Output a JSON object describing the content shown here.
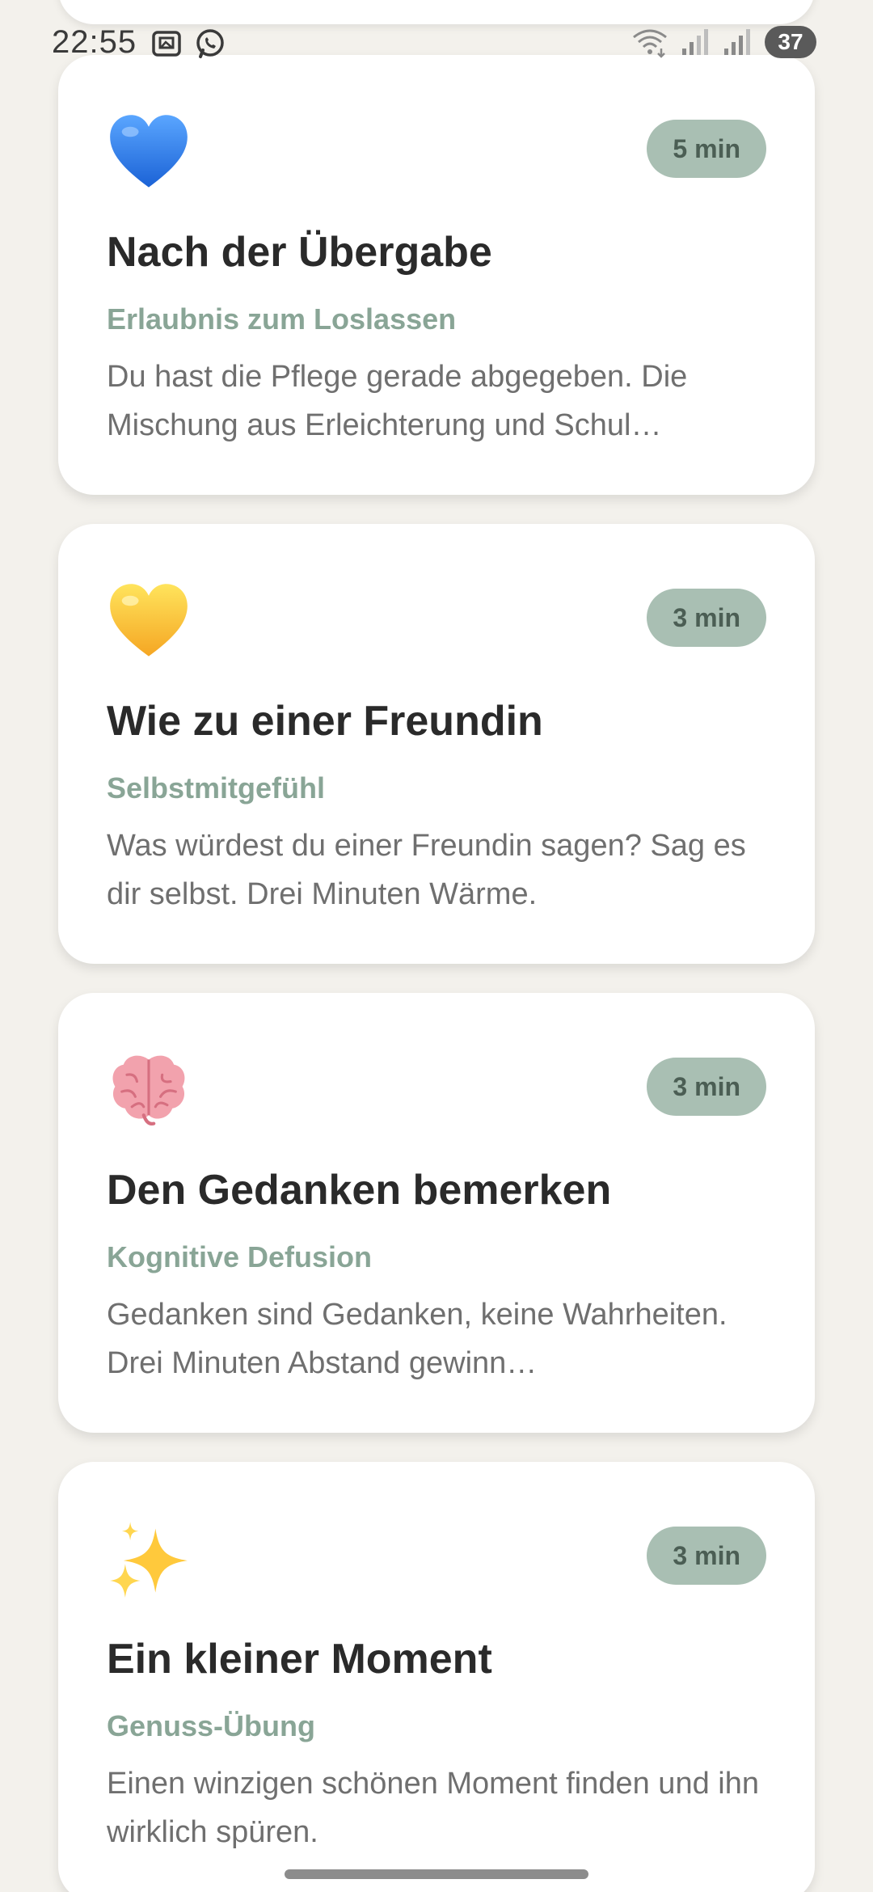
{
  "status_bar": {
    "time": "22:55",
    "battery": "37",
    "left_icons": [
      "gallery-notification-icon",
      "whatsapp-icon"
    ],
    "right_icons": [
      "wifi-icon",
      "signal-icon",
      "signal-icon"
    ]
  },
  "exercises": [
    {
      "emoji": "blue-heart",
      "duration": "5 min",
      "title": "Nach der Übergabe",
      "subtitle": "Erlaubnis zum Loslassen",
      "description": "Du hast die Pflege gerade abgegeben. Die Mischung aus Erleichterung und Schul…"
    },
    {
      "emoji": "yellow-heart",
      "duration": "3 min",
      "title": "Wie zu einer Freundin",
      "subtitle": "Selbstmitgefühl",
      "description": "Was würdest du einer Freundin sagen? Sag es dir selbst. Drei Minuten Wärme."
    },
    {
      "emoji": "brain",
      "duration": "3 min",
      "title": "Den Gedanken bemerken",
      "subtitle": "Kognitive Defusion",
      "description": "Gedanken sind Gedanken, keine Wahrheiten. Drei Minuten Abstand gewinn…"
    },
    {
      "emoji": "sparkles",
      "duration": "3 min",
      "title": "Ein kleiner Moment",
      "subtitle": "Genuss-Übung",
      "description": "Einen winzigen schönen Moment finden und ihn wirklich spüren."
    }
  ],
  "colors": {
    "background": "#f3f1ec",
    "card": "#ffffff",
    "badge": "#a9bfb3",
    "badge_text": "#4b5e54",
    "subtitle": "#89a596",
    "title": "#2a2a2a",
    "description": "#6f6f6f"
  }
}
